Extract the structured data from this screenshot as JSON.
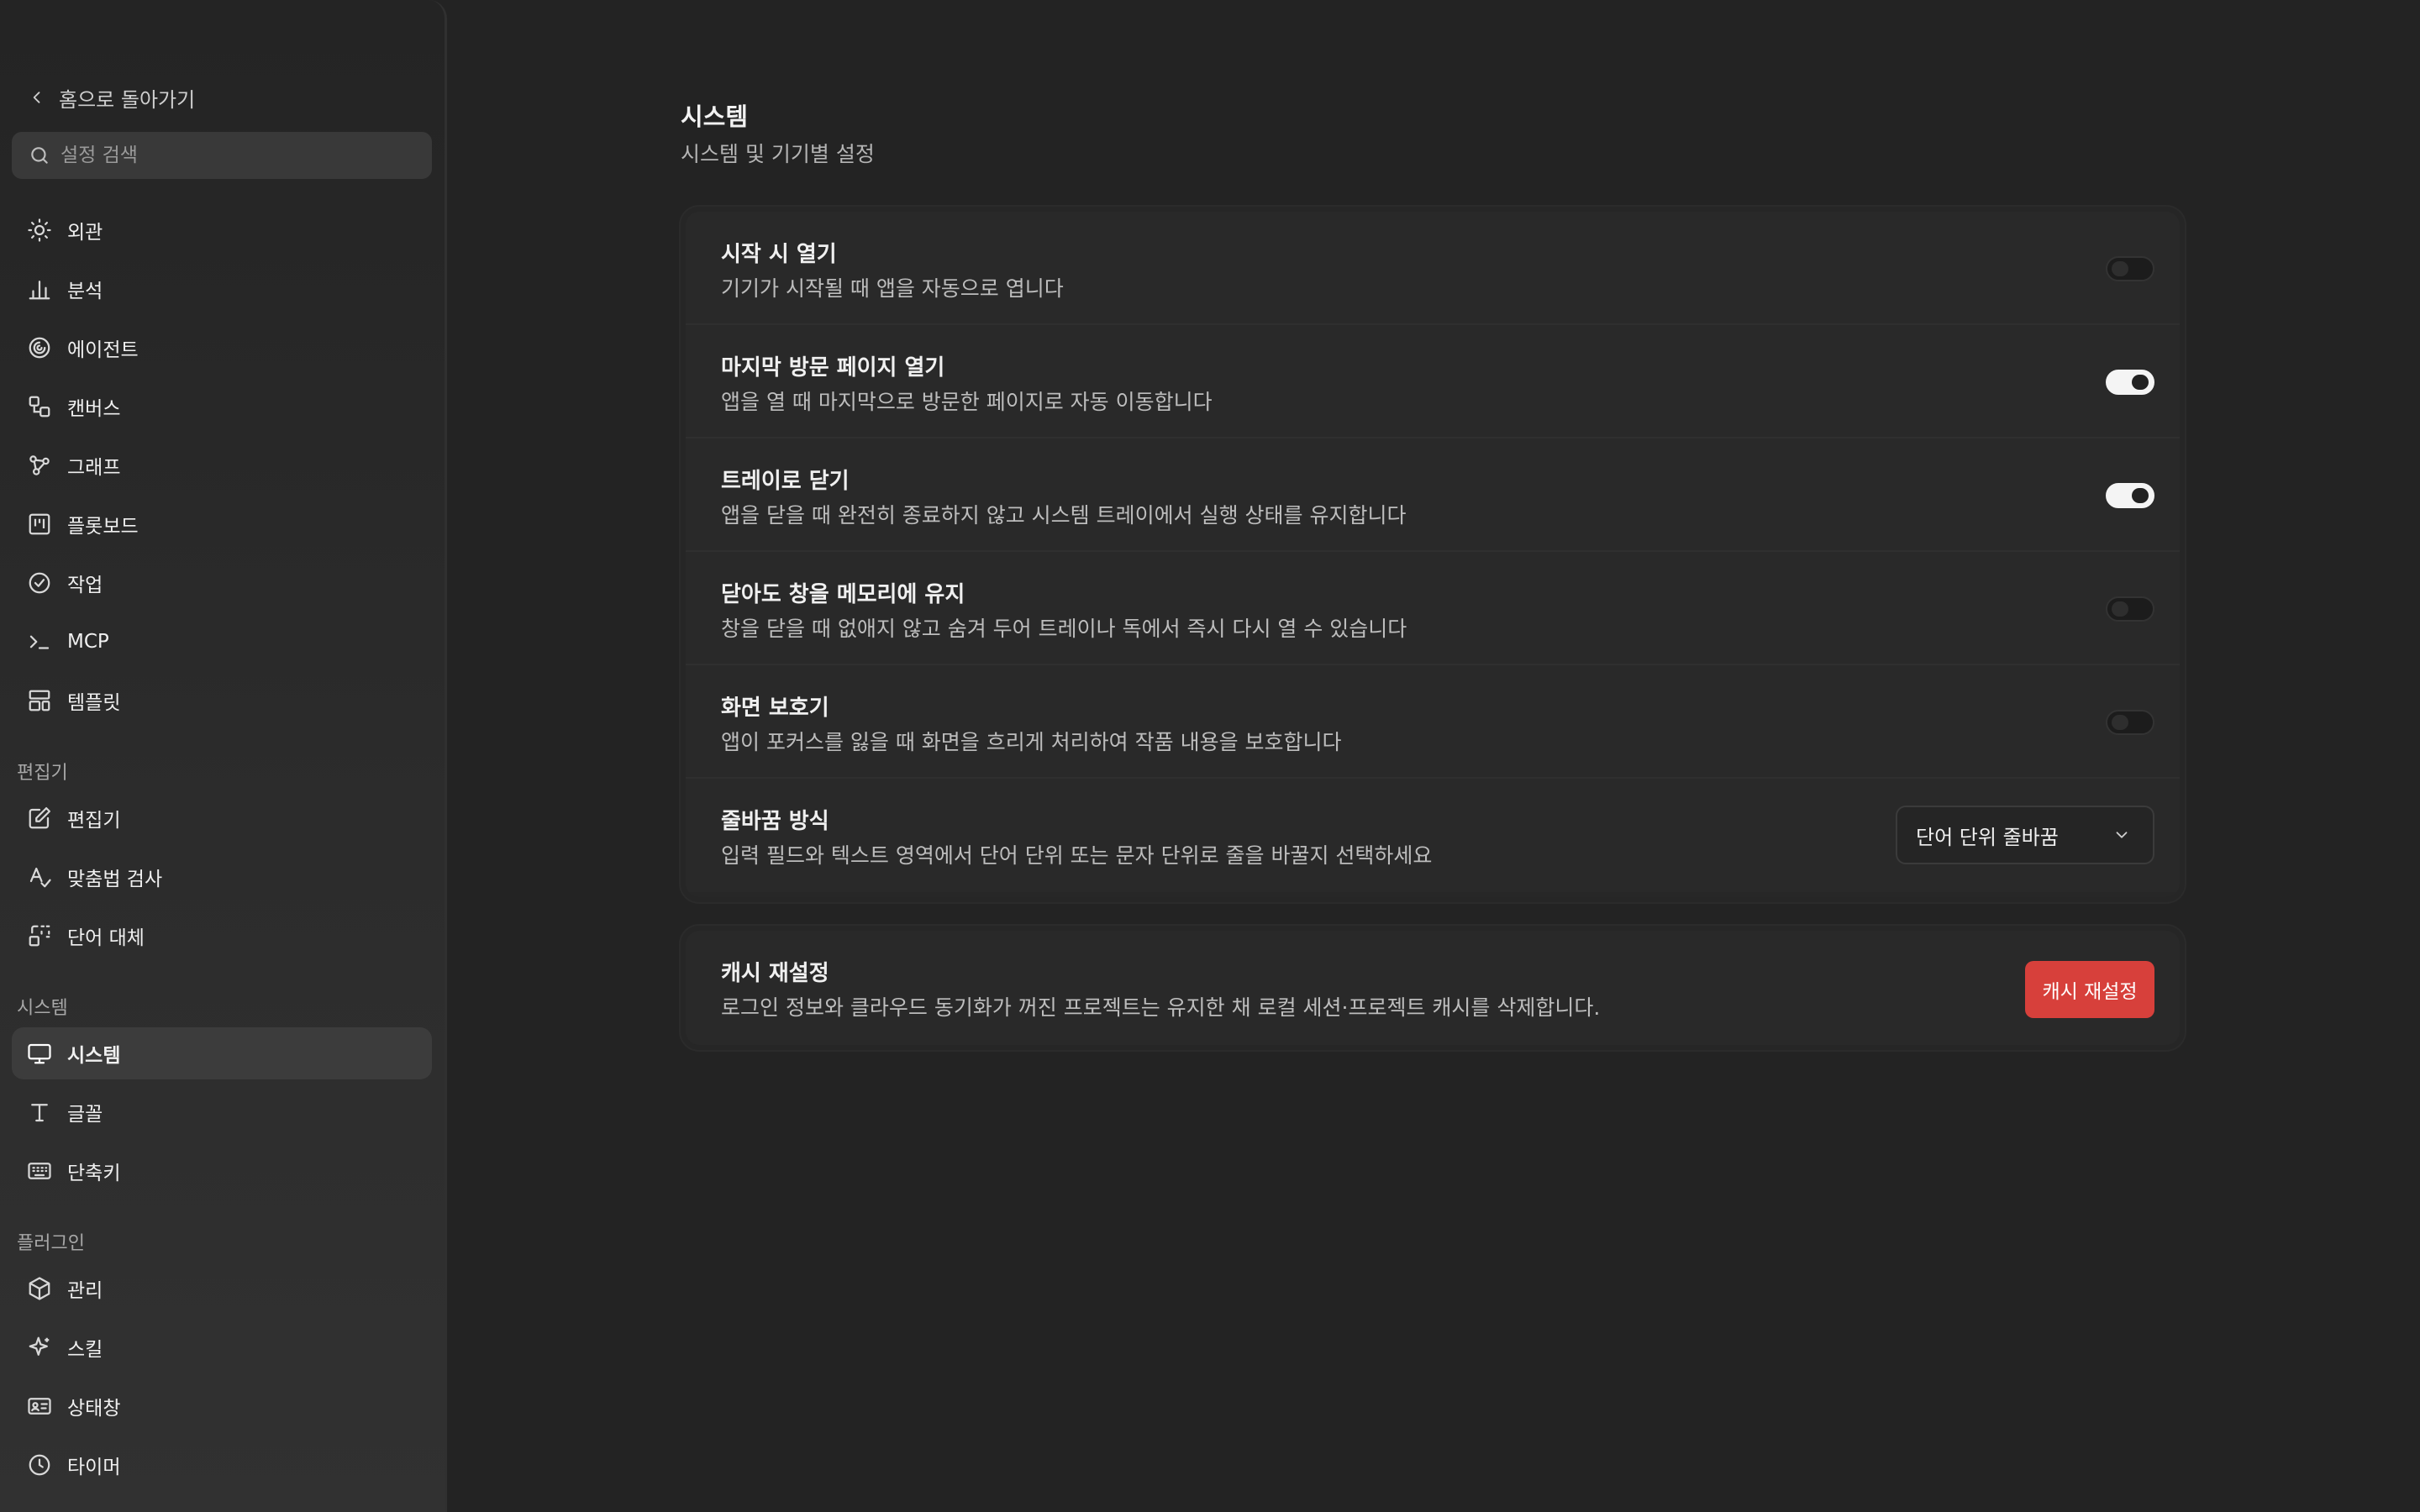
{
  "sidebar": {
    "back_label": "홈으로 돌아가기",
    "search_placeholder": "설정 검색",
    "items": [
      {
        "label": "외관",
        "icon": "sun-icon"
      },
      {
        "label": "분석",
        "icon": "bar-chart-icon"
      },
      {
        "label": "에이전트",
        "icon": "spiral-icon"
      },
      {
        "label": "캔버스",
        "icon": "shapes-icon"
      },
      {
        "label": "그래프",
        "icon": "graph-nodes-icon"
      },
      {
        "label": "플롯보드",
        "icon": "kanban-icon"
      },
      {
        "label": "작업",
        "icon": "check-circle-icon"
      },
      {
        "label": "MCP",
        "icon": "terminal-icon"
      },
      {
        "label": "템플릿",
        "icon": "layout-template-icon"
      }
    ],
    "section_editor": "편집기",
    "editor_items": [
      {
        "label": "편집기",
        "icon": "edit-icon"
      },
      {
        "label": "맞춤법 검사",
        "icon": "spell-check-icon"
      },
      {
        "label": "단어 대체",
        "icon": "replace-icon"
      }
    ],
    "section_system": "시스템",
    "system_items": [
      {
        "label": "시스템",
        "icon": "monitor-icon",
        "active": true
      },
      {
        "label": "글꼴",
        "icon": "type-icon"
      },
      {
        "label": "단축키",
        "icon": "keyboard-icon"
      }
    ],
    "section_plugin": "플러그인",
    "plugin_items": [
      {
        "label": "관리",
        "icon": "package-icon"
      },
      {
        "label": "스킬",
        "icon": "sparkles-icon"
      },
      {
        "label": "상태창",
        "icon": "id-card-icon"
      },
      {
        "label": "타이머",
        "icon": "clock-icon"
      }
    ]
  },
  "main": {
    "title": "시스템",
    "subtitle": "시스템 및 기기별 설정",
    "settings": [
      {
        "title": "시작 시 열기",
        "desc": "기기가 시작될 때 앱을 자동으로 엽니다",
        "enabled": false
      },
      {
        "title": "마지막 방문 페이지 열기",
        "desc": "앱을 열 때 마지막으로 방문한 페이지로 자동 이동합니다",
        "enabled": true
      },
      {
        "title": "트레이로 닫기",
        "desc": "앱을 닫을 때 완전히 종료하지 않고 시스템 트레이에서 실행 상태를 유지합니다",
        "enabled": true
      },
      {
        "title": "닫아도 창을 메모리에 유지",
        "desc": "창을 닫을 때 없애지 않고 숨겨 두어 트레이나 독에서 즉시 다시 열 수 있습니다",
        "enabled": false
      },
      {
        "title": "화면 보호기",
        "desc": "앱이 포커스를 잃을 때 화면을 흐리게 처리하여 작품 내용을 보호합니다",
        "enabled": false
      }
    ],
    "wrap": {
      "title": "줄바꿈 방식",
      "desc": "입력 필드와 텍스트 영역에서 단어 단위 또는 문자 단위로 줄을 바꿀지 선택하세요",
      "selected": "단어 단위 줄바꿈"
    },
    "cache": {
      "title": "캐시 재설정",
      "desc": "로그인 정보와 클라우드 동기화가 꺼진 프로젝트는 유지한 채 로컬 세션·프로젝트 캐시를 삭제합니다.",
      "button": "캐시 재설정"
    }
  },
  "colors": {
    "background": "#232323",
    "sidebar": "#2a2a2a",
    "danger": "#d7403b",
    "toggle_on": "#f4f4f4"
  }
}
